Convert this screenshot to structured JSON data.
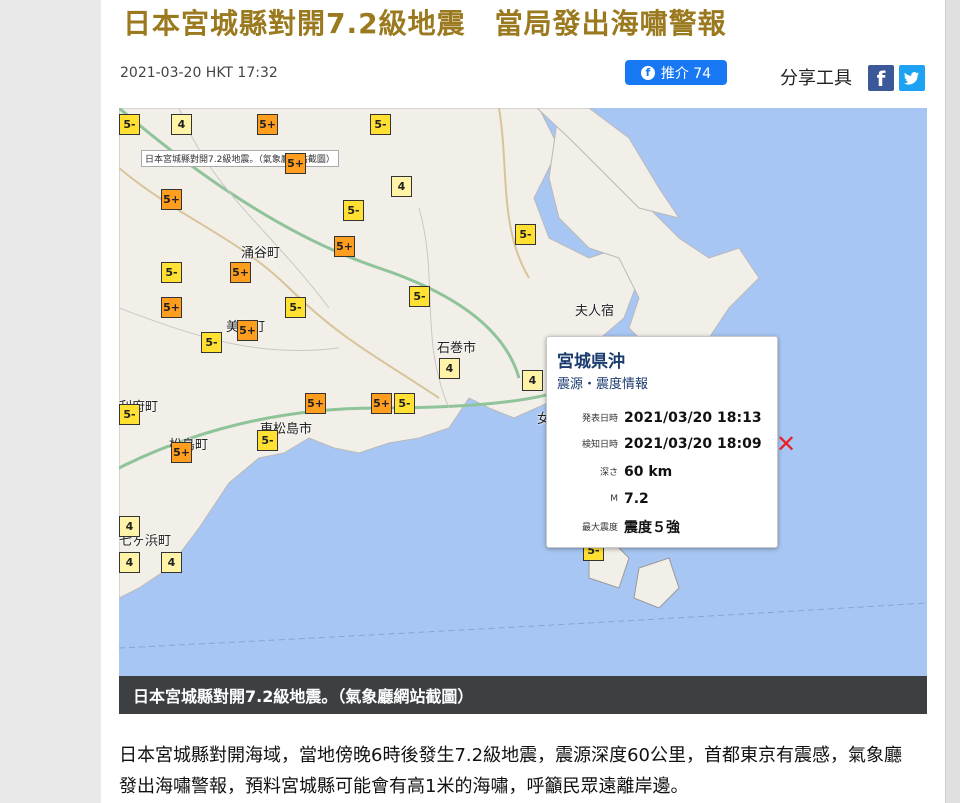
{
  "article": {
    "headline": "日本宮城縣對開7.2級地震　當局發出海嘯警報",
    "date": "2021-03-20 HKT 17:32",
    "like_label": "推介 74",
    "share_label": "分享工具",
    "body": "日本宮城縣對開海域，當地傍晚6時後發生7.2級地震，震源深度60公里，首都東京有震感，氣象廳發出海嘯警報，預料宮城縣可能會有高1米的海嘯，呼籲民眾遠離岸邊。",
    "caption": "日本宮城縣對開7.2級地震。（氣象廳網站截圖）"
  },
  "colors": {
    "headline": "#9b7a1f",
    "like_button": "#1877f2",
    "facebook": "#3b5998",
    "twitter": "#1da1f2",
    "caption_bar": "#3c4043",
    "sea": "#a8c6f3",
    "intensity_4": "#fff3a8",
    "intensity_5_weak": "#ffe033",
    "intensity_5_strong": "#ff9d1e",
    "epicenter": "#e8202a"
  },
  "icons": {
    "like": "facebook-f-icon",
    "facebook": "facebook-icon",
    "twitter": "twitter-icon",
    "epicenter": "x-mark-icon"
  },
  "map": {
    "tag": "日本宮城縣對開7.2級地震。（氣象廳網站截圖）",
    "places": [
      "涌谷町",
      "美里町",
      "石巻市",
      "東松島市",
      "松島町",
      "女川町",
      "利府町",
      "七ヶ浜町",
      "夫人宿"
    ],
    "intensity_labels": {
      "s4": "4",
      "s5m": "5-",
      "s5p": "5+"
    },
    "popup": {
      "title": "宮城県沖",
      "subtitle": "震源・震度情報",
      "announce_label": "発表日時",
      "announce_value": "2021/03/20 18:13",
      "detect_label": "検知日時",
      "detect_value": "2021/03/20 18:09",
      "depth_label": "深さ",
      "depth_value": "60 km",
      "mag_label": "M",
      "mag_value": "7.2",
      "maxint_label": "最大震度",
      "maxint_value": "震度５強"
    },
    "epicenter_mark": "✕"
  }
}
